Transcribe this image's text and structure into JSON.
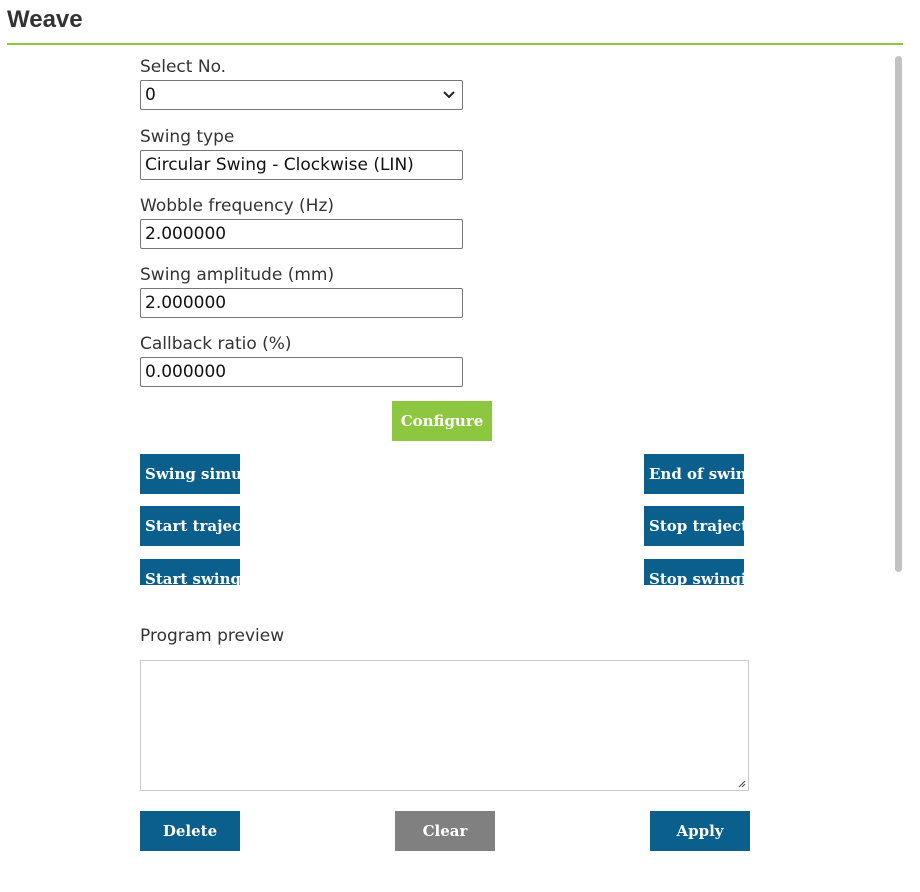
{
  "header": {
    "title": "Weave"
  },
  "form": {
    "select_no": {
      "label": "Select No.",
      "value": "0"
    },
    "swing_type": {
      "label": "Swing type",
      "value": "Circular Swing - Clockwise (LIN)"
    },
    "wobble_frequency": {
      "label": "Wobble frequency (Hz)",
      "value": "2.000000"
    },
    "swing_amplitude": {
      "label": "Swing amplitude (mm)",
      "value": "2.000000"
    },
    "callback_ratio": {
      "label": "Callback ratio (%)",
      "value": "0.000000"
    },
    "configure_label": "Configure"
  },
  "actions": {
    "swing_simulation": "Swing simu",
    "end_of_swing": "End of swin",
    "start_trajectory": "Start trajec",
    "stop_trajectory": "Stop traject",
    "start_swing": "Start swing",
    "stop_swing": "Stop swingi"
  },
  "preview": {
    "label": "Program preview",
    "value": ""
  },
  "footer": {
    "delete_label": "Delete",
    "clear_label": "Clear",
    "apply_label": "Apply"
  },
  "colors": {
    "accent_green": "#8dc63f",
    "button_blue": "#0b5f8c",
    "button_gray": "#808080"
  }
}
